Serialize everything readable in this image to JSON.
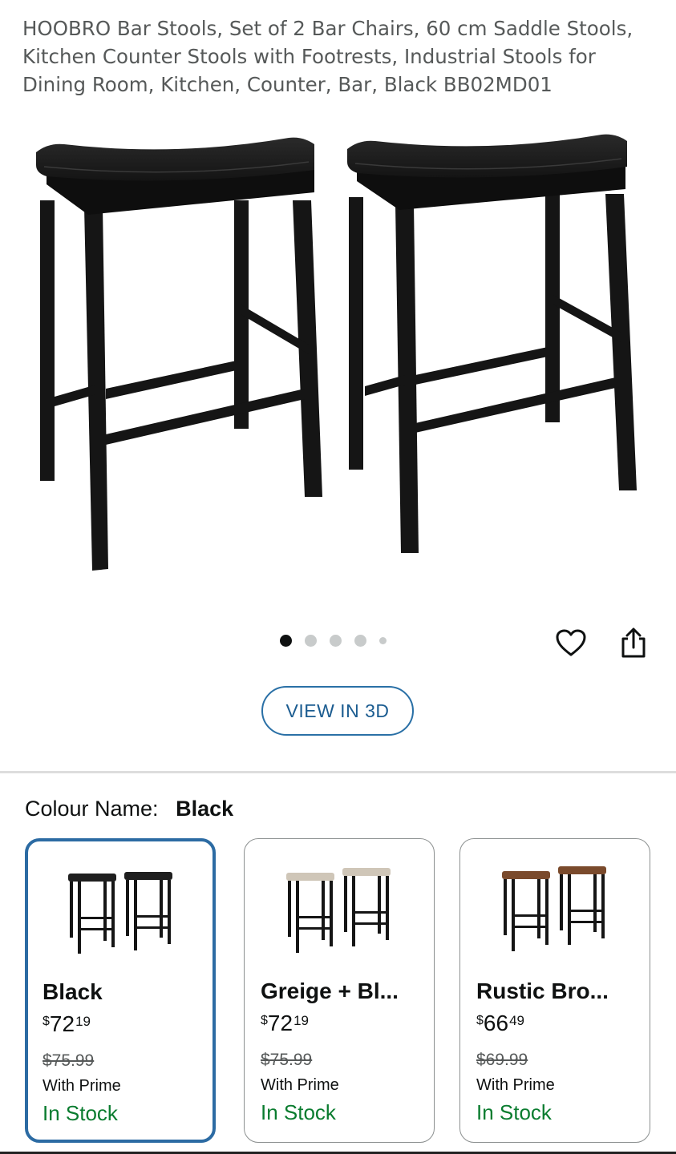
{
  "product": {
    "title": "HOOBRO Bar Stools, Set of 2 Bar Chairs, 60 cm Saddle Stools, Kitchen Counter Stools with Footrests, Industrial Stools for Dining Room, Kitchen, Counter, Bar, Black BB02MD01"
  },
  "gallery": {
    "image_count": 5,
    "active_index": 0,
    "view3d_label": "VIEW IN 3D",
    "icons": {
      "favorite": "heart-icon",
      "share": "share-icon"
    }
  },
  "colour": {
    "label": "Colour Name:",
    "selected": "Black"
  },
  "swatches": [
    {
      "name": "Black",
      "currency": "$",
      "price_whole": "72",
      "price_fraction": "19",
      "was_price": "$75.99",
      "prime": "With Prime",
      "stock": "In Stock",
      "seat_color": "#1f1f1f",
      "selected": true
    },
    {
      "name": "Greige + Bl...",
      "currency": "$",
      "price_whole": "72",
      "price_fraction": "19",
      "was_price": "$75.99",
      "prime": "With Prime",
      "stock": "In Stock",
      "seat_color": "#cfc6b8",
      "selected": false
    },
    {
      "name": "Rustic Bro...",
      "currency": "$",
      "price_whole": "66",
      "price_fraction": "49",
      "was_price": "$69.99",
      "prime": "With Prime",
      "stock": "In Stock",
      "seat_color": "#7a4a2c",
      "selected": false
    }
  ],
  "colors": {
    "link": "#1b5c90",
    "in_stock": "#0a7c2f",
    "selected_border": "#2c6ba3",
    "stool_frame": "#151515"
  }
}
